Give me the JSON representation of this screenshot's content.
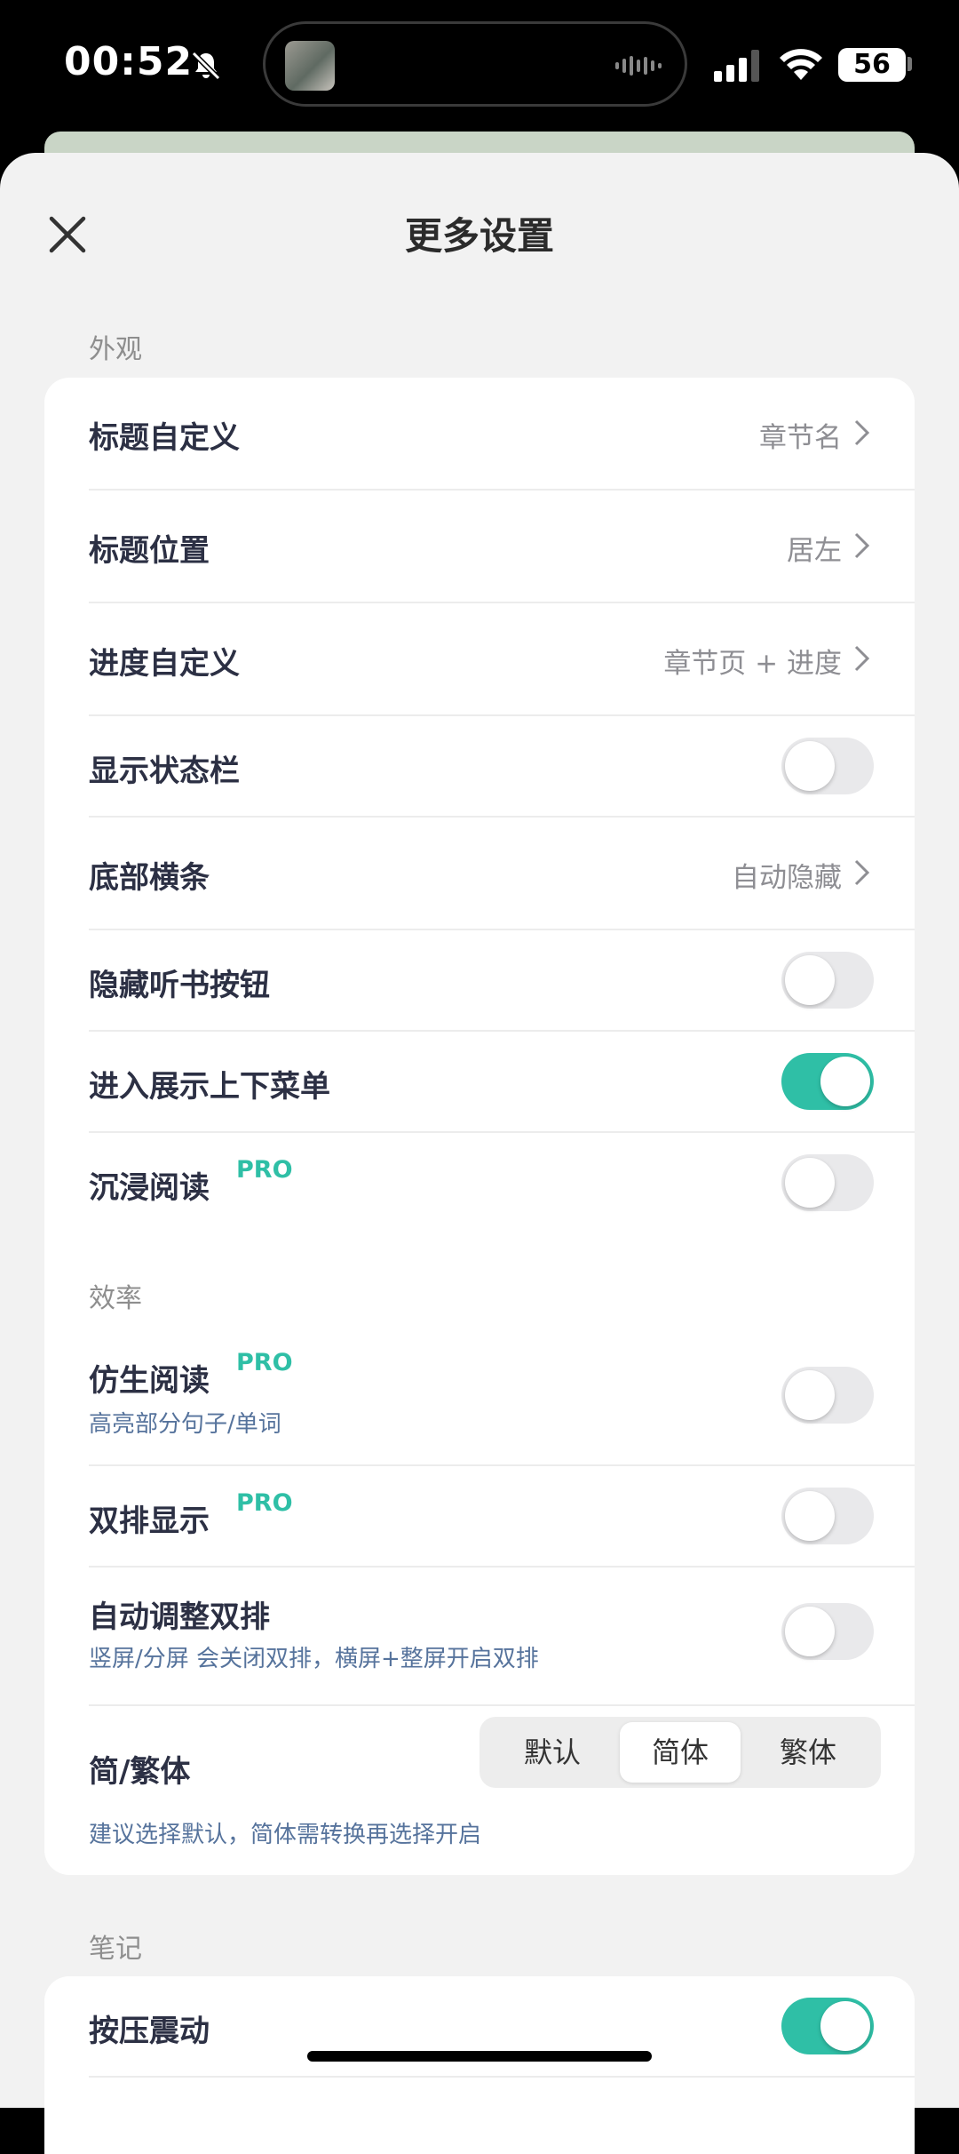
{
  "status_bar": {
    "time": "00:52",
    "battery": "56"
  },
  "header": {
    "title": "更多设置"
  },
  "sections": {
    "appearance": {
      "label": "外观",
      "title_custom": {
        "label": "标题自定义",
        "value": "章节名"
      },
      "title_position": {
        "label": "标题位置",
        "value": "居左"
      },
      "progress_custom": {
        "label": "进度自定义",
        "value": "章节页 + 进度"
      },
      "show_status_bar": {
        "label": "显示状态栏",
        "on": false
      },
      "bottom_bar": {
        "label": "底部横条",
        "value": "自动隐藏"
      },
      "hide_listen_button": {
        "label": "隐藏听书按钮",
        "on": false
      },
      "show_menus_on_enter": {
        "label": "进入展示上下菜单",
        "on": true
      },
      "immersive_reading": {
        "label": "沉浸阅读",
        "badge": "PRO",
        "on": false
      }
    },
    "efficiency": {
      "label": "效率",
      "bionic_reading": {
        "label": "仿生阅读",
        "badge": "PRO",
        "sub": "高亮部分句子/单词",
        "on": false
      },
      "dual_column": {
        "label": "双排显示",
        "badge": "PRO",
        "on": false
      },
      "auto_dual_column": {
        "label": "自动调整双排",
        "sub": "竖屏/分屏 会关闭双排，横屏+整屏开启双排",
        "on": false
      },
      "script_variant": {
        "label": "简/繁体",
        "options": [
          "默认",
          "简体",
          "繁体"
        ],
        "selected": "简体",
        "hint": "建议选择默认，简体需转换再选择开启"
      }
    },
    "notes": {
      "label": "笔记",
      "press_vibration": {
        "label": "按压震动",
        "on": true
      }
    }
  },
  "colors": {
    "accent": "#2fbfa6",
    "sub_text": "#56739c",
    "background": "#f2f2f2"
  }
}
